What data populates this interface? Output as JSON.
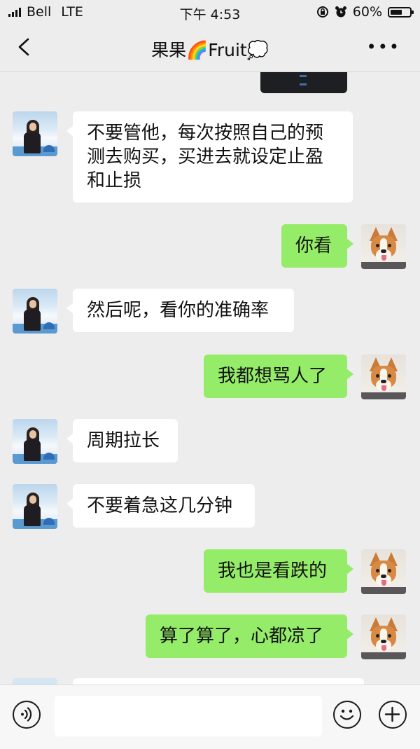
{
  "status_bar": {
    "carrier": "Bell",
    "network": "LTE",
    "time": "下午 4:53",
    "battery_percent": "60%",
    "battery_level": 0.6
  },
  "nav": {
    "title": "果果🌈Fruit💭",
    "back_icon": "chevron-left-icon",
    "more_icon": "more-dots-icon"
  },
  "messages": [
    {
      "side": "in",
      "text": "不要管他，每次按照自己的预\n测去购买，买进去就设定止盈\n和止损"
    },
    {
      "side": "out",
      "text": "你看"
    },
    {
      "side": "in",
      "text": "然后呢，看你的准确率"
    },
    {
      "side": "out",
      "text": "我都想骂人了"
    },
    {
      "side": "in",
      "text": "周期拉长"
    },
    {
      "side": "in",
      "text": "不要着急这几分钟"
    },
    {
      "side": "out",
      "text": "我也是看跌的"
    },
    {
      "side": "out",
      "text": "算了算了，心都凉了"
    }
  ],
  "input_bar": {
    "text_value": "",
    "voice_icon": "voice-icon",
    "emoji_icon": "emoji-icon",
    "plus_icon": "plus-icon"
  },
  "colors": {
    "background": "#ededed",
    "incoming_bubble": "#ffffff",
    "outgoing_bubble": "#95ec69"
  }
}
